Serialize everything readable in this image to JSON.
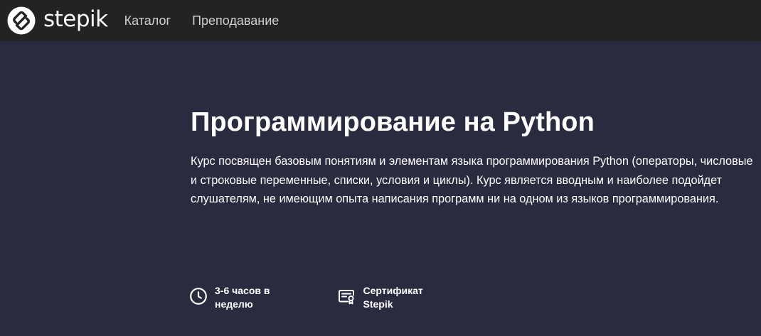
{
  "header": {
    "logo_text": "stepik",
    "nav": [
      {
        "label": "Каталог"
      },
      {
        "label": "Преподавание"
      }
    ]
  },
  "course": {
    "title": "Программирование на Python",
    "description": "Курс посвящен базовым понятиям и элементам языка программирования Python (операторы, числовые и строковые переменные, списки, условия и циклы). Курс является вводным и наиболее подойдет слушателям, не имеющим опыта написания программ ни на одном из языков программирования.",
    "features": [
      {
        "icon": "clock-icon",
        "line1": "3-6 часов в",
        "line2": "неделю"
      },
      {
        "icon": "certificate-icon",
        "line1": "Сертификат",
        "line2": "Stepik"
      }
    ]
  },
  "colors": {
    "topbar": "#232323",
    "hero_bg": "#2b2b40",
    "text": "#ffffff",
    "nav_text": "#cfcfcf"
  }
}
